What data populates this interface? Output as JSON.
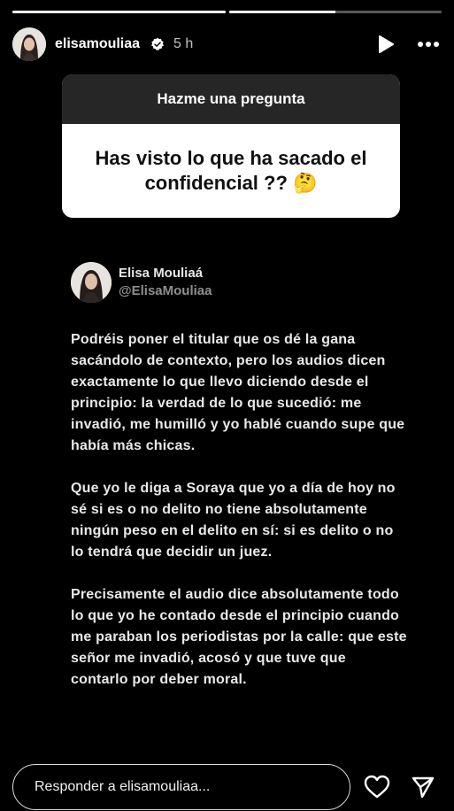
{
  "progress": [
    1.0,
    0.5
  ],
  "header": {
    "username": "elisamouliaa",
    "time": "5 h",
    "icons": [
      "verified-icon",
      "play-icon",
      "more-icon"
    ]
  },
  "sticker": {
    "title": "Hazme una pregunta",
    "question": "Has visto lo que ha sacado el confidencial ?? 🤔"
  },
  "post": {
    "name": "Elisa Mouliaá",
    "handle": "@ElisaMouliaa",
    "paragraphs": [
      "Podréis poner el titular que os dé la gana sacándolo de contexto, pero los audios dicen exactamente lo que llevo diciendo desde el principio: la verdad de lo que sucedió: me invadió, me humilló y yo hablé cuando supe que había más chicas.",
      "Que yo le diga a Soraya que yo a día de hoy no sé si es o no delito no tiene absolutamente ningún peso en el delito en sí: si es delito o no lo tendrá que decidir un juez.",
      "Precisamente el audio dice absolutamente todo lo que yo he contado desde el principio cuando me paraban los periodistas por la calle: que este señor me invadió, acosó y que tuve que contarlo por deber moral."
    ]
  },
  "reply": {
    "placeholder": "Responder a elisamouliaa...",
    "icons": [
      "heart-icon",
      "send-icon"
    ]
  }
}
